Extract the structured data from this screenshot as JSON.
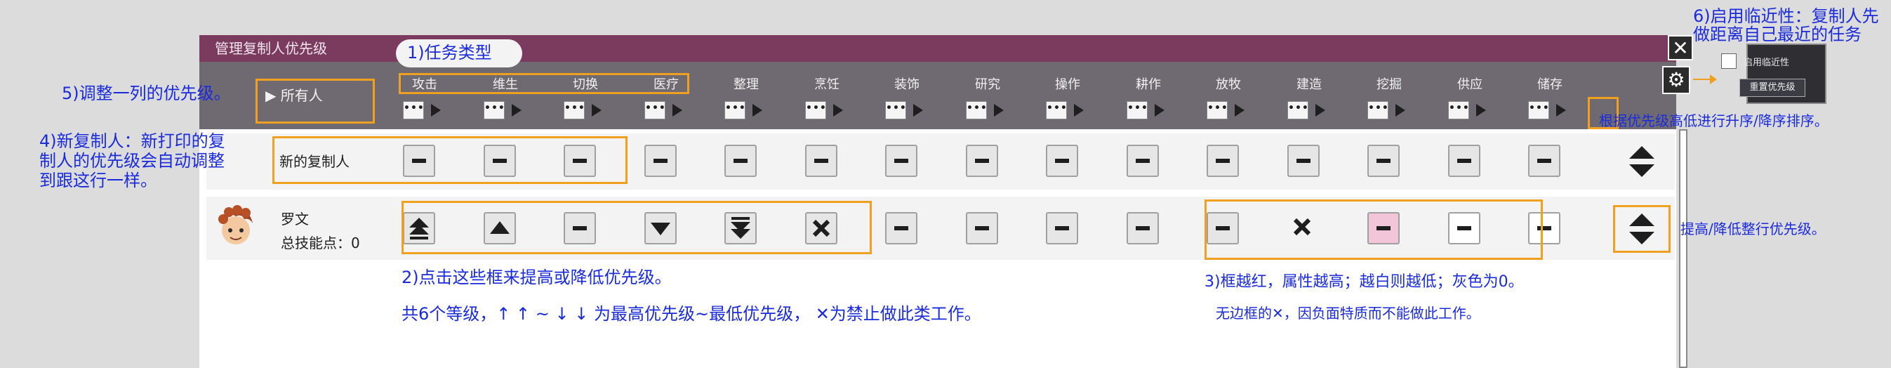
{
  "window": {
    "title": "管理复制人优先级",
    "close_icon": "close-icon",
    "settings_icon": "gear-icon"
  },
  "header": {
    "all_label": "所有人",
    "jobs": [
      "攻击",
      "维生",
      "切换",
      "医疗",
      "整理",
      "烹饪",
      "装饰",
      "研究",
      "操作",
      "耕作",
      "放牧",
      "建造",
      "挖掘",
      "供应",
      "储存"
    ]
  },
  "settings_panel": {
    "proximity_label": "启用临近性",
    "reset_label": "重置优先级"
  },
  "rows": {
    "new_dupe": {
      "label": "新的复制人",
      "priorities": [
        "neutral",
        "neutral",
        "neutral",
        "neutral",
        "neutral",
        "neutral",
        "neutral",
        "neutral",
        "neutral",
        "neutral",
        "neutral",
        "neutral",
        "neutral",
        "neutral",
        "neutral"
      ]
    },
    "dupe": {
      "name": "罗文",
      "skill_points_label": "总技能点：0",
      "priorities": [
        "very-high",
        "high",
        "neutral",
        "low",
        "very-low",
        "disabled",
        "neutral",
        "neutral",
        "neutral",
        "neutral",
        "neutral",
        "disabled-trait",
        "neutral-pink",
        "neutral-white",
        "neutral-white"
      ]
    }
  },
  "annotations": {
    "n1": "1)任务类型",
    "n2a": "2)点击这些框来提高或降低优先级。",
    "n2b": "共6个等级，↑ ↑ ~ ↓ ↓ 为最高优先级~最低优先级， ✕为禁止做此类工作。",
    "n3a": "3)框越红，属性越高；越白则越低；灰色为0。",
    "n3b": "无边框的✕，因负面特质而不能做此工作。",
    "n4": "4)新复制人：新打印的复制人的优先级会自动调整到跟这行一样。",
    "n4_lines": [
      "4)新复制人：新打印的复",
      "制人的优先级会自动调整",
      "到跟这行一样。"
    ],
    "n5": "5)调整一列的优先级。",
    "n6_lines": [
      "6)启用临近性：复制人先",
      "做距离自己最近的任务"
    ],
    "n_sort": "根据优先级高低进行升序/降序排序。",
    "n_row": "提高/降低整行优先级。"
  },
  "colors": {
    "title_bar": "#7b3b5e",
    "header_bg": "#6f6a72",
    "highlight_box": "#f0a020",
    "annotation_text": "#1a2bdc",
    "pink_cell": "#f2c6d8"
  }
}
